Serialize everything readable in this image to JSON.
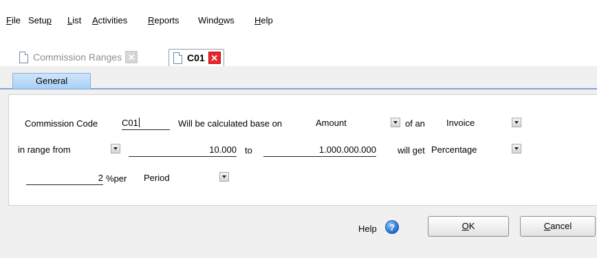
{
  "menu": {
    "items": [
      {
        "label": "File",
        "mnemonic": "F",
        "rest": "ile"
      },
      {
        "label": "Setup",
        "pre": "Setu",
        "mnemonic": "p"
      },
      {
        "label": "List",
        "mnemonic": "L",
        "rest": "ist"
      },
      {
        "label": "Activities",
        "mnemonic": "A",
        "rest": "ctivities"
      },
      {
        "label": "Reports",
        "mnemonic": "R",
        "rest": "eports"
      },
      {
        "label": "Windows",
        "pre": "Wind",
        "mnemonic": "o",
        "rest": "ws"
      },
      {
        "label": "Help",
        "mnemonic": "H",
        "rest": "elp"
      }
    ]
  },
  "tabs": {
    "inactive_label": "Commission Ranges",
    "active_label": "C01",
    "close_glyph": "✕"
  },
  "subtab": {
    "label": "General"
  },
  "form": {
    "commission_code_label": "Commission Code",
    "commission_code_value": "C01",
    "calculated_label": "Will be calculated base on",
    "base_value": "Amount",
    "of_an_label": "of an",
    "document_value": "Invoice",
    "range_type_value": "in range from",
    "range_from_value": "10.000",
    "to_label": "to",
    "range_to_value": "1.000.000.000",
    "will_get_label": "will get",
    "type_value": "Percentage",
    "rate_value": "2",
    "percent_per_label": "%per",
    "period_value": "Period"
  },
  "footer": {
    "help_label": "Help",
    "help_icon_glyph": "?",
    "ok": {
      "mnemonic": "O",
      "rest": "K"
    },
    "cancel": {
      "mnemonic": "C",
      "rest": "ancel"
    }
  },
  "colors": {
    "close_active": "#e8262b",
    "subtab_blue": "#a8d0f4",
    "help_icon": "#1f6fd0"
  }
}
